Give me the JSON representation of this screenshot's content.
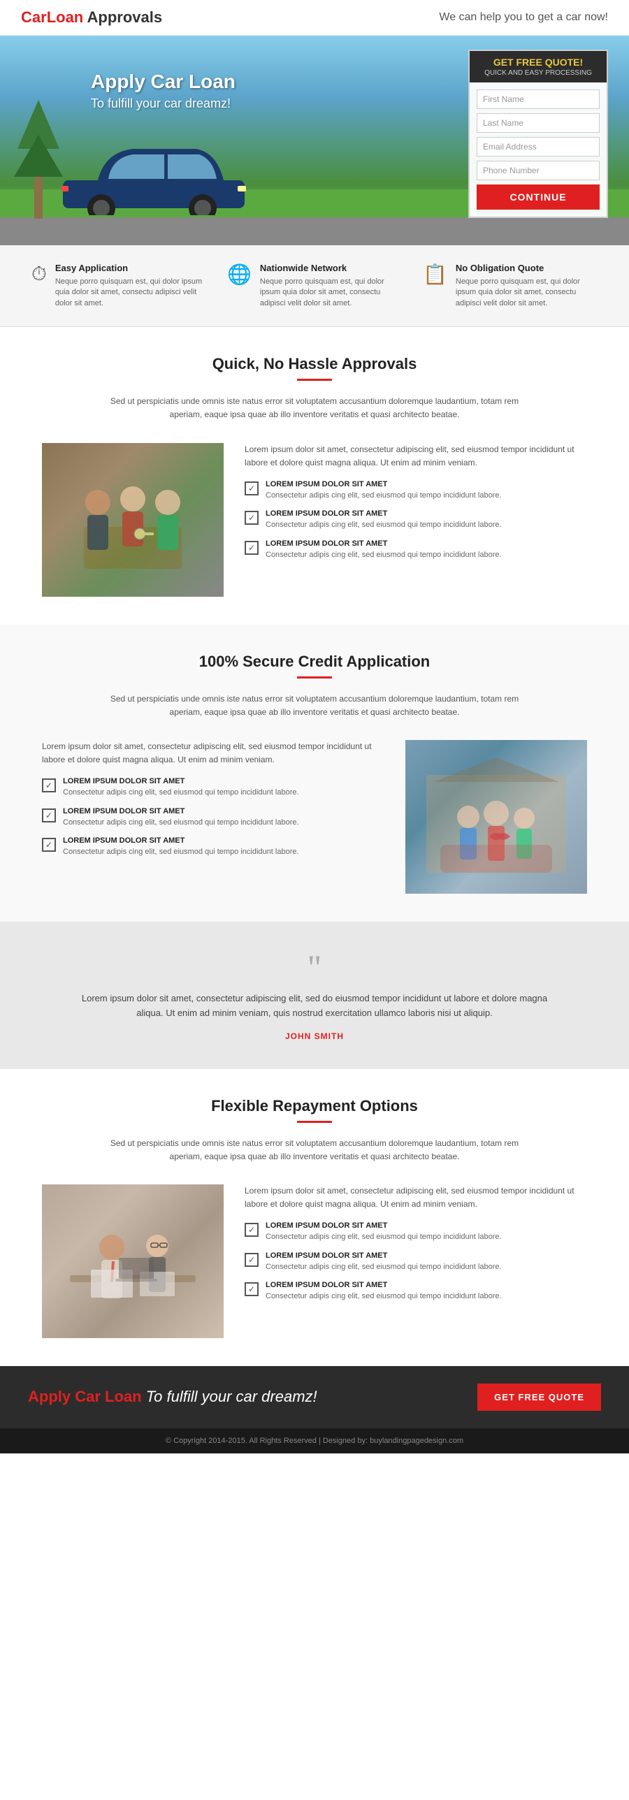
{
  "header": {
    "logo_car": "Car",
    "logo_loan": "Loan",
    "logo_approvals": " Approvals",
    "tagline": "We can help you to get a car now!"
  },
  "hero": {
    "apply_text": "Apply Car Loan",
    "apply_sub": "To fulfill your car dreamz!",
    "quote_box": {
      "header": "GET FREE QUOTE!",
      "subheader": "QUICK AND EASY PROCESSING",
      "fields": [
        {
          "placeholder": "First Name",
          "id": "first-name"
        },
        {
          "placeholder": "Last Name",
          "id": "last-name"
        },
        {
          "placeholder": "Email Address",
          "id": "email"
        },
        {
          "placeholder": "Phone Number",
          "id": "phone"
        }
      ],
      "button": "CONTINUE"
    }
  },
  "features": [
    {
      "icon": "⏱",
      "title": "Easy Application",
      "text": "Neque porro quisquam est, qui dolor ipsum quia dolor sit amet, consectu adipisci velit dolor sit amet."
    },
    {
      "icon": "🌐",
      "title": "Nationwide Network",
      "text": "Neque porro quisquam est, qui dolor ipsum quia dolor sit amet, consectu adipisci velit dolor sit amet."
    },
    {
      "icon": "📋",
      "title": "No Obligation Quote",
      "text": "Neque porro quisquam est, qui dolor ipsum quia dolor sit amet, consectu adipisci velit dolor sit amet."
    }
  ],
  "section1": {
    "title": "Quick, No Hassle Approvals",
    "subtitle": "Sed ut perspiciatis unde omnis iste natus error sit voluptatem accusantium doloremque laudantium,\ntotam rem aperiam, eaque ipsa quae ab illo inventore veritatis et quasi architecto beatae.",
    "intro": "Lorem ipsum dolor sit amet, consectetur adipiscing elit, sed eiusmod tempor incididunt ut labore et dolore quist magna aliqua. Ut enim ad minim veniam.",
    "items": [
      {
        "title": "LOREM IPSUM DOLOR SIT AMET",
        "text": "Consectetur adipis cing elit, sed eiusmod qui tempo incididunt labore."
      },
      {
        "title": "LOREM IPSUM DOLOR SIT AMET",
        "text": "Consectetur adipis cing elit, sed eiusmod qui tempo incididunt labore."
      },
      {
        "title": "LOREM IPSUM DOLOR SIT AMET",
        "text": "Consectetur adipis cing elit, sed eiusmod qui tempo incididunt labore."
      }
    ]
  },
  "section2": {
    "title": "100% Secure Credit Application",
    "subtitle": "Sed ut perspiciatis unde omnis iste natus error sit voluptatem accusantium doloremque laudantium,\ntotam rem aperiam, eaque ipsa quae ab illo inventore veritatis et quasi architecto beatae.",
    "intro": "Lorem ipsum dolor sit amet, consectetur adipiscing elit, sed eiusmod tempor incididunt ut labore et dolore quist magna aliqua. Ut enim ad minim veniam.",
    "items": [
      {
        "title": "LOREM IPSUM DOLOR SIT AMET",
        "text": "Consectetur adipis cing elit, sed eiusmod qui tempo incididunt labore."
      },
      {
        "title": "LOREM IPSUM DOLOR SIT AMET",
        "text": "Consectetur adipis cing elit, sed eiusmod qui tempo incididunt labore."
      },
      {
        "title": "LOREM IPSUM DOLOR SIT AMET",
        "text": "Consectetur adipis cing elit, sed eiusmod qui tempo incididunt labore."
      }
    ]
  },
  "testimonial": {
    "text": "Lorem ipsum dolor sit amet, consectetur adipiscing elit, sed do eiusmod tempor incididunt ut labore et dolore magna aliqua. Ut enim ad minim veniam, quis nostrud exercitation ullamco laboris nisi ut aliquip.",
    "name": "JOHN SMITH"
  },
  "section3": {
    "title": "Flexible Repayment Options",
    "subtitle": "Sed ut perspiciatis unde omnis iste natus error sit voluptatem accusantium doloremque laudantium,\ntotam rem aperiam, eaque ipsa quae ab illo inventore veritatis et quasi architecto beatae.",
    "intro": "Lorem ipsum dolor sit amet, consectetur adipiscing elit, sed eiusmod tempor incididunt ut labore et dolore quist magna aliqua. Ut enim ad minim veniam.",
    "items": [
      {
        "title": "LOREM IPSUM DOLOR SIT AMET",
        "text": "Consectetur adipis cing elit, sed eiusmod qui tempo incididunt labore."
      },
      {
        "title": "LOREM IPSUM DOLOR SIT AMET",
        "text": "Consectetur adipis cing elit, sed eiusmod qui tempo incididunt labore."
      },
      {
        "title": "LOREM IPSUM DOLOR SIT AMET",
        "text": "Consectetur adipis cing elit, sed eiusmod qui tempo incididunt labore."
      }
    ]
  },
  "footer_cta": {
    "text1": "Apply Car Loan",
    "text2": "To fulfill your car dreamz!",
    "button": "GET FREE QUOTE"
  },
  "footer": {
    "copyright": "© Copyright 2014-2015. All Rights Reserved  |  Designed by: buylandingpagedesign.com"
  }
}
